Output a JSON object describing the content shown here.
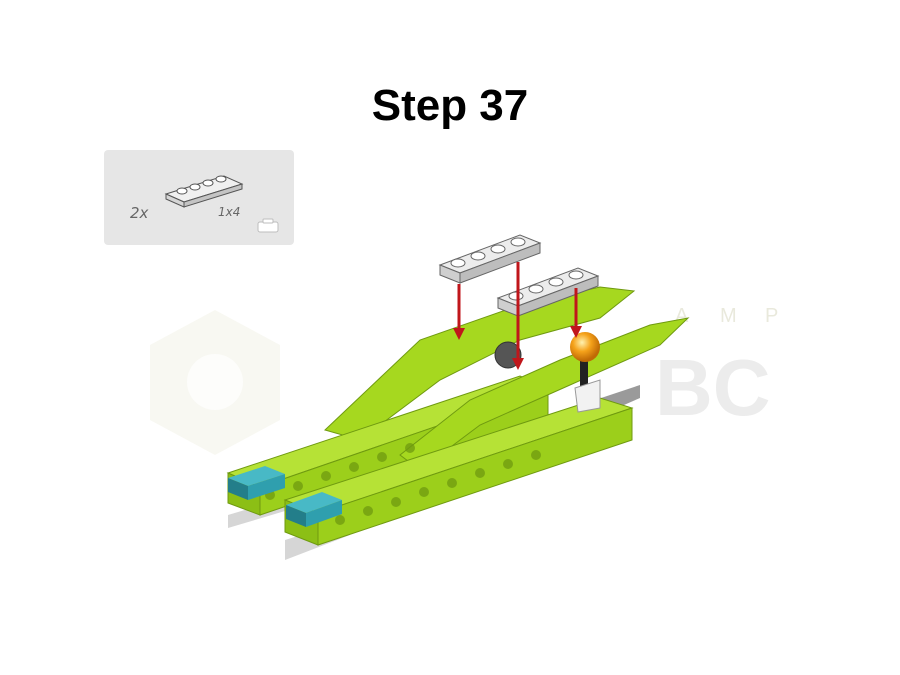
{
  "step": {
    "title": "Step 37"
  },
  "parts_list": {
    "quantity": "2x",
    "part_size": "1x4",
    "part_icon": "gray-1x4-plate-icon"
  },
  "watermark": {
    "letters": [
      "A",
      "M",
      "P"
    ],
    "logo": "BC"
  },
  "colors": {
    "lime": "#a6d81f",
    "lime_dark": "#7fae12",
    "plate_gray": "#d2d2d2",
    "teal": "#2f9fae",
    "arrow_red": "#c0161b",
    "ball_orange": "#f5a21a",
    "panel_bg": "#e6e6e6"
  }
}
